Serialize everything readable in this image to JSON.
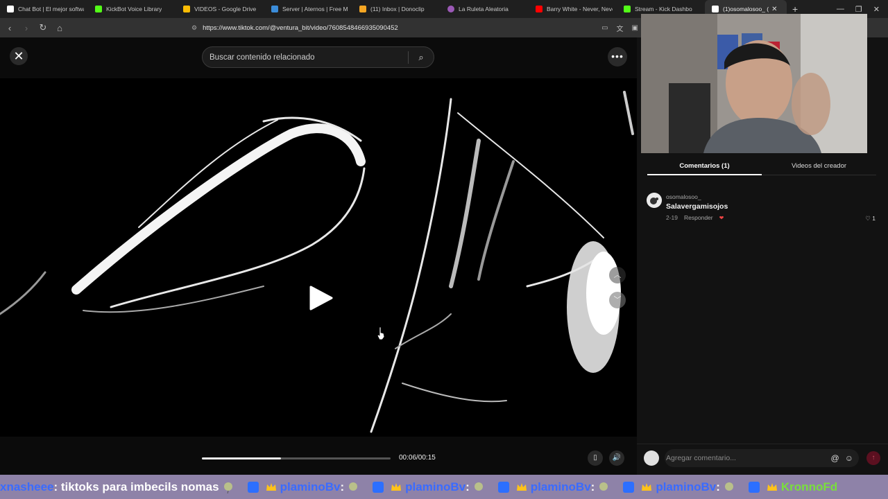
{
  "browser": {
    "tabs": [
      {
        "title": "Chat Bot | El mejor softwa",
        "color": "#ffffff"
      },
      {
        "title": "KickBot Voice Library",
        "color": "#53fc18"
      },
      {
        "title": "VIDEOS - Google Drive",
        "color": "#fbbc04"
      },
      {
        "title": "Server | Aternos | Free Mi",
        "color": "#3b8cd9"
      },
      {
        "title": "(11) Inbox | Donoclip",
        "color": "#f5a623"
      },
      {
        "title": "La Ruleta Aleatoria",
        "color": "#9b59b6"
      },
      {
        "title": "Barry White - Never, Neve",
        "color": "#ff0000"
      },
      {
        "title": "Stream - Kick Dashbo",
        "color": "#53fc18"
      },
      {
        "title": "(1)osomalosoo_ (",
        "color": "#ffffff"
      }
    ],
    "url": "https://www.tiktok.com/@ventura_bit/video/7608548466935090452"
  },
  "tiktok": {
    "search_placeholder": "Buscar contenido relacionado",
    "time": "00:06/00:15",
    "progress": 0.42,
    "panel_tabs": {
      "comments": "Comentarios (1)",
      "creator_videos": "Videos del creador"
    },
    "comment": {
      "user": "osomalosoo_",
      "text": "Salavergamisojos",
      "date": "2-19",
      "reply": "Responder",
      "likes": "1"
    },
    "comment_placeholder": "Agregar comentario..."
  },
  "chat_ticker": [
    {
      "user": "xnasheee",
      "message": ": tiktoks para imbecils nomas"
    },
    {
      "user": "plaminoBv",
      "message": ":"
    },
    {
      "user": "plaminoBv",
      "message": ":"
    },
    {
      "user": "plaminoBv",
      "message": ":"
    },
    {
      "user": "plaminoBv",
      "message": ":"
    },
    {
      "user": "KronnoFd",
      "message": ""
    }
  ],
  "colors": {
    "ticker_bg": "#8e82a8",
    "ticker_user": "#3a6bff",
    "send_button": "#5b1020"
  }
}
